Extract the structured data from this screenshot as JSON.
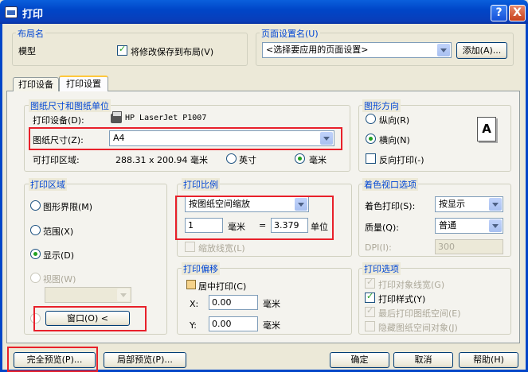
{
  "window": {
    "title": "打印",
    "help": "?",
    "close": "X"
  },
  "layout": {
    "legend": "布局名",
    "name": "模型",
    "save_changes": "将修改保存到布局(V)",
    "save_checked": true
  },
  "page_setup": {
    "legend": "页面设置名(U)",
    "selected": "<选择要应用的页面设置>",
    "add_button": "添加(A)..."
  },
  "tabs": [
    {
      "label": "打印设备"
    },
    {
      "label": "打印设置"
    }
  ],
  "paper": {
    "legend": "图纸尺寸和图纸单位",
    "device_label": "打印设备(D):",
    "device_value": "HP LaserJet P1007",
    "size_label": "图纸尺寸(Z):",
    "size_value": "A4",
    "area_label": "可打印区域:",
    "area_value": "288.31 x 200.94 毫米",
    "unit_inch": "英寸",
    "unit_mm": "毫米"
  },
  "orientation": {
    "legend": "图形方向",
    "portrait": "纵向(R)",
    "landscape": "横向(N)",
    "reverse": "反向打印(-)",
    "icon_letter": "A"
  },
  "plot_area": {
    "legend": "打印区域",
    "limits": "图形界限(M)",
    "extents": "范围(X)",
    "display": "显示(D)",
    "view": "视图(W)",
    "window_button": "窗口(O) <"
  },
  "scale": {
    "legend": "打印比例",
    "selected": "按图纸空间缩放",
    "value1": "1",
    "unit1": "毫米",
    "equals": "=",
    "value2": "3.379",
    "unit2": "单位",
    "scale_lineweights": "缩放线宽(L)"
  },
  "offset": {
    "legend": "打印偏移",
    "center": "居中打印(C)",
    "x_label": "X:",
    "x_value": "0.00",
    "x_unit": "毫米",
    "y_label": "Y:",
    "y_value": "0.00",
    "y_unit": "毫米"
  },
  "shaded": {
    "legend": "着色视口选项",
    "shade_label": "着色打印(S):",
    "shade_value": "按显示",
    "quality_label": "质量(Q):",
    "quality_value": "普通",
    "dpi_label": "DPI(I):",
    "dpi_value": "300"
  },
  "options": {
    "legend": "打印选项",
    "lineweights": "打印对象线宽(G)",
    "plotstyles": "打印样式(Y)",
    "paperspace_last": "最后打印图纸空间(E)",
    "hide_objects": "隐藏图纸空间对象(J)"
  },
  "buttons": {
    "full_preview": "完全预览(P)...",
    "partial_preview": "局部预览(P)...",
    "ok": "确定",
    "cancel": "取消",
    "help": "帮助(H)"
  }
}
